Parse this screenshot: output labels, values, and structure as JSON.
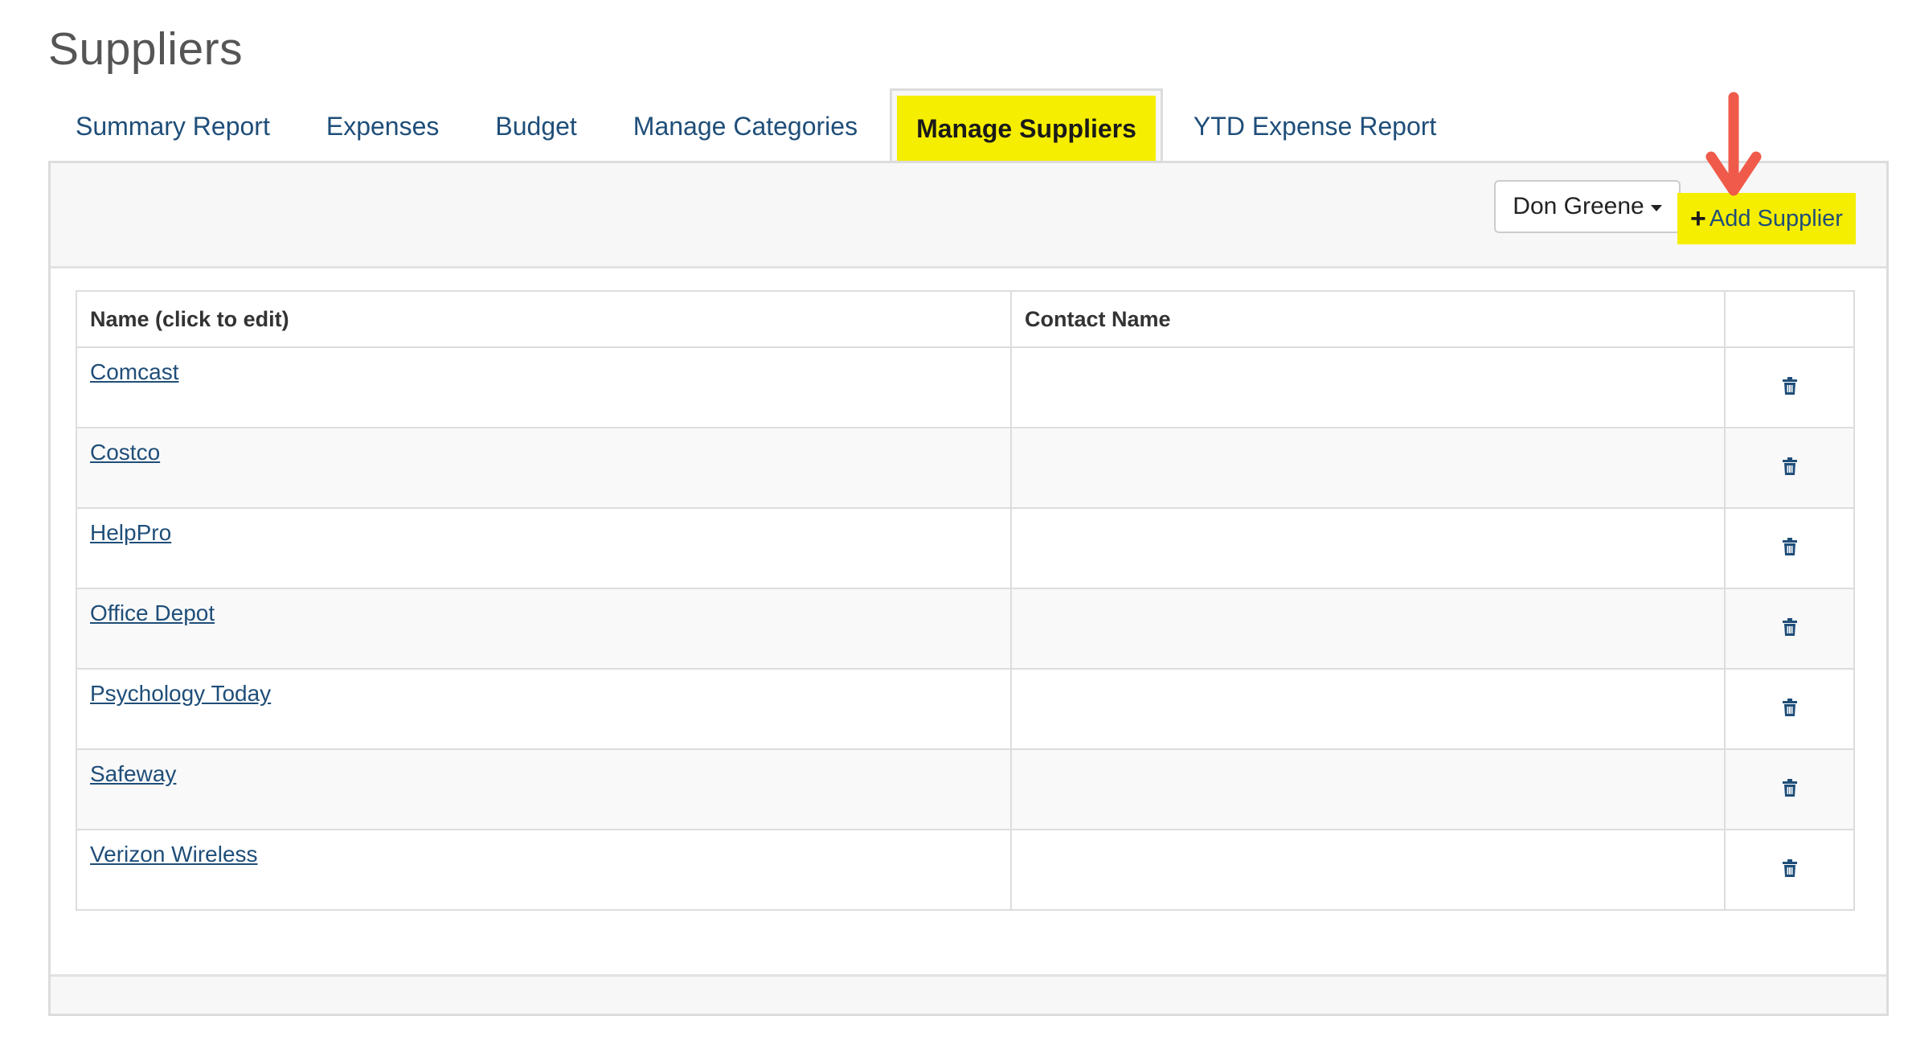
{
  "page": {
    "title": "Suppliers"
  },
  "tabs": [
    {
      "label": "Summary Report",
      "active": false
    },
    {
      "label": "Expenses",
      "active": false
    },
    {
      "label": "Budget",
      "active": false
    },
    {
      "label": "Manage Categories",
      "active": false
    },
    {
      "label": "Manage Suppliers",
      "active": true
    },
    {
      "label": "YTD Expense Report",
      "active": false
    }
  ],
  "toolbar": {
    "user_label": "Don Greene",
    "add_plus": "+",
    "add_label": "Add Supplier"
  },
  "table": {
    "headers": [
      "Name (click to edit)",
      "Contact Name",
      ""
    ],
    "rows": [
      {
        "name": "Comcast",
        "contact": ""
      },
      {
        "name": "Costco",
        "contact": ""
      },
      {
        "name": "HelpPro",
        "contact": ""
      },
      {
        "name": "Office Depot",
        "contact": ""
      },
      {
        "name": "Psychology Today",
        "contact": ""
      },
      {
        "name": "Safeway",
        "contact": ""
      },
      {
        "name": "Verizon Wireless",
        "contact": ""
      }
    ]
  },
  "colors": {
    "highlight": "#f6ee00",
    "link": "#1f4e79",
    "arrow": "#f05a4a"
  },
  "icons": {
    "delete": "trash-icon",
    "dropdown": "caret-down-icon",
    "annotation": "arrow-down-icon"
  }
}
